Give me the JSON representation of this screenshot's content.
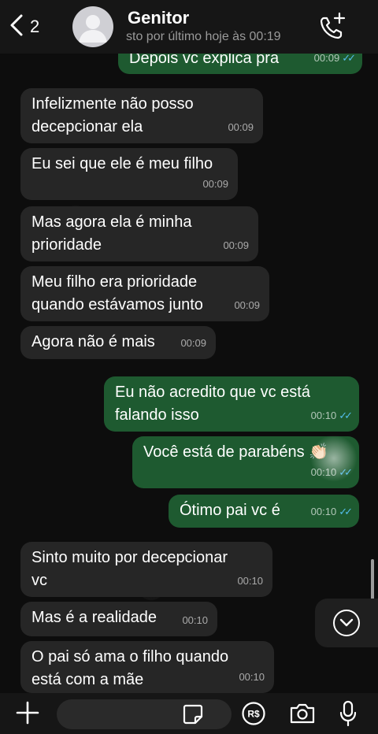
{
  "header": {
    "back_count": "2",
    "contact_name": "Genitor",
    "status": "isto por último hoje às 00:19",
    "status_visible": "sto por último hoje às 00:19"
  },
  "messages": [
    {
      "dir": "out",
      "text": "Depois vc explica pra",
      "time": "00:09",
      "read": true
    },
    {
      "dir": "in",
      "text": "Infelizmente não posso\ndecepcionar ela",
      "time": "00:09"
    },
    {
      "dir": "in",
      "text": "Eu sei que ele é meu filho",
      "time": "00:09"
    },
    {
      "dir": "in",
      "text": "Mas agora ela é minha\nprioridade",
      "time": "00:09"
    },
    {
      "dir": "in",
      "text": "Meu filho era prioridade\nquando estávamos junto",
      "time": "00:09"
    },
    {
      "dir": "in",
      "text": "Agora não é mais",
      "time": "00:09"
    },
    {
      "dir": "out",
      "text": "Eu não acredito que vc está\nfalando isso",
      "time": "00:10",
      "read": true
    },
    {
      "dir": "out",
      "text": "Você está de parabéns 👏🏻",
      "time": "00:10",
      "read": true
    },
    {
      "dir": "out",
      "text": "Ótimo pai vc é",
      "time": "00:10",
      "read": true
    },
    {
      "dir": "in",
      "text": "Sinto muito por decepcionar\nvc",
      "time": "00:10"
    },
    {
      "dir": "in",
      "text": "Mas é a realidade",
      "time": "00:10"
    },
    {
      "dir": "in",
      "text": "O pai só ama o filho quando\nestá com a mãe",
      "time": "00:10"
    }
  ],
  "read_ticks": "✓✓",
  "colors": {
    "incoming": "#262626",
    "outgoing": "#1e5a30",
    "ticks": "#53bdeb"
  },
  "icons": {
    "back": "chevron-left-icon",
    "avatar": "person-icon",
    "call": "phone-plus-icon",
    "scroll": "chevron-down-icon",
    "attach": "plus-icon",
    "sticker": "sticker-icon",
    "payment": "pix-icon",
    "camera": "camera-icon",
    "mic": "microphone-icon"
  },
  "input": {
    "placeholder": ""
  }
}
